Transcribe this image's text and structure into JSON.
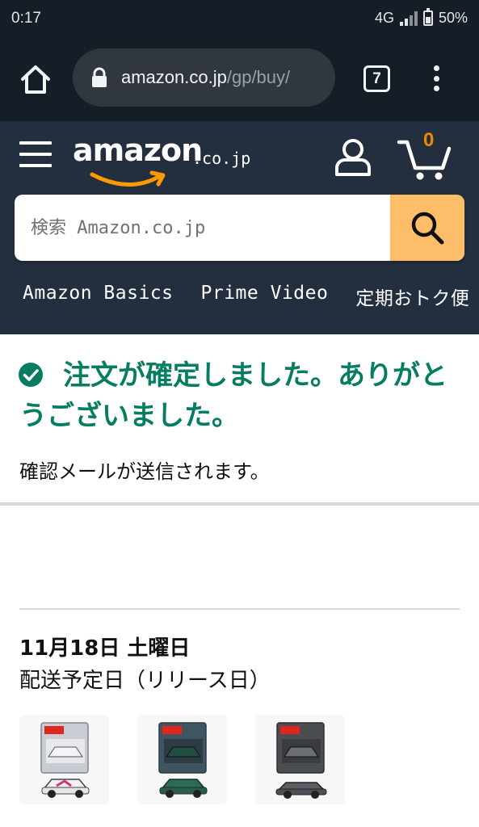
{
  "status_bar": {
    "time": "0:17",
    "network": "4G",
    "battery": "50%"
  },
  "browser": {
    "url_host": "amazon.co.jp",
    "url_path": "/gp/buy/",
    "tab_count": "7"
  },
  "header": {
    "logo_text": "amazon",
    "logo_suffix": ".co.jp",
    "cart_count": "0",
    "search_placeholder": "検索 Amazon.co.jp",
    "nav_links": [
      "Amazon Basics",
      "Prime Video",
      "定期おトク便"
    ]
  },
  "confirmation": {
    "title": "注文が確定しました。ありがとうございました。",
    "subtitle": "確認メールが送信されます。"
  },
  "delivery": {
    "date": "11月18日 土曜日",
    "label": "配送予定日（リリース日）"
  },
  "products": [
    {
      "icon": "toy-car-white-package"
    },
    {
      "icon": "toy-car-green-package"
    },
    {
      "icon": "toy-car-grey-package"
    }
  ],
  "colors": {
    "browser_bg": "#151e27",
    "header_bg": "#232f3e",
    "search_button": "#febd69",
    "cart_count": "#f08804",
    "success_green": "#067d62"
  }
}
